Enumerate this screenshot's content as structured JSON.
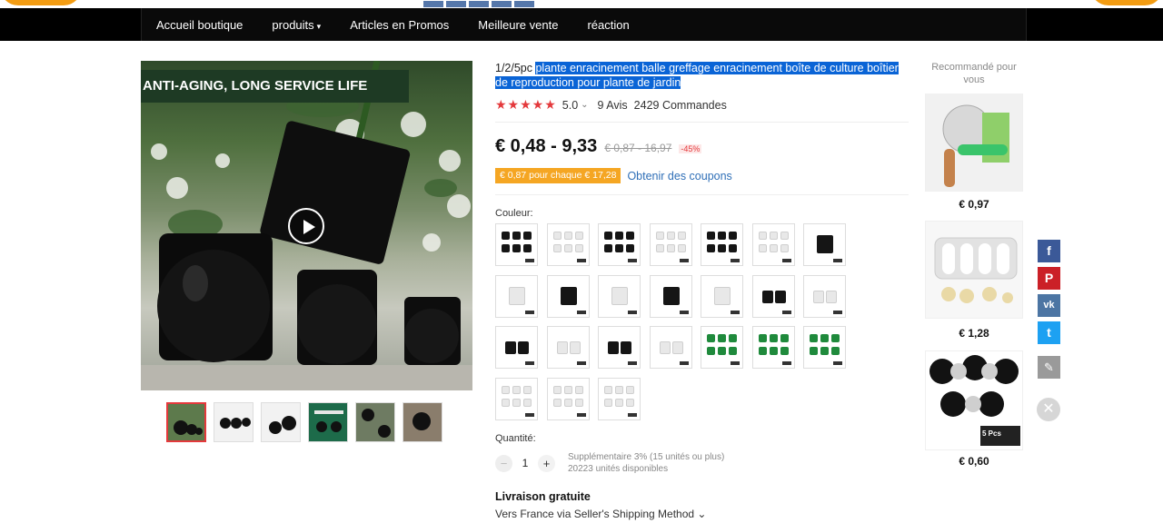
{
  "nav": {
    "items": [
      {
        "label": "Accueil boutique"
      },
      {
        "label": "produits",
        "chevron": "▾"
      },
      {
        "label": "Articles en Promos"
      },
      {
        "label": "Meilleure vente"
      },
      {
        "label": "réaction"
      }
    ]
  },
  "gallery": {
    "banner": "ANTI-AGING, LONG SERVICE LIFE",
    "play_icon": "play-icon"
  },
  "product": {
    "title_plain": "1/2/5pc ",
    "title_highlight": "plante enracinement balle greffage enracinement boîte de culture boîtier de reproduction pour plante de jardin",
    "stars": "★★★★★",
    "rating": "5.0",
    "rating_chevron": "⌄",
    "reviews": "9 Avis",
    "orders": "2429 Commandes",
    "price": "€ 0,48 - 9,33",
    "old_price": "€ 0,87 - 16,97",
    "discount": "-45%",
    "coupon_tag": "€ 0,87 pour chaque € 17,28",
    "coupon_link": "Obtenir des coupons",
    "color_label": "Couleur:",
    "quantity_label": "Quantité:",
    "quantity_minus": "−",
    "quantity_value": "1",
    "quantity_plus": "+",
    "quantity_info_1": "Supplémentaire 3% (15 unités ou plus)",
    "quantity_info_2": "20223 unités disponibles",
    "shipping_title": "Livraison gratuite",
    "shipping_sub": "Vers France via Seller's Shipping Method ⌄"
  },
  "recommended": {
    "title": "Recommandé pour vous",
    "items": [
      {
        "price": "€ 0,97"
      },
      {
        "price": "€ 1,28"
      },
      {
        "price": "€ 0,60",
        "badge": "5 Pcs"
      }
    ]
  },
  "share": {
    "facebook": "f",
    "pinterest": "P",
    "vk": "vk",
    "twitter": "t",
    "edit": "✎",
    "close": "✕"
  },
  "colors": {
    "facebook": "#3b5998",
    "pinterest": "#cb2027",
    "vk": "#4c75a3",
    "twitter": "#1da1f2",
    "edit": "#9a9a9a",
    "swatch_black": "#151515",
    "swatch_white": "#e8e8e8",
    "swatch_green": "#1f8a3c"
  }
}
